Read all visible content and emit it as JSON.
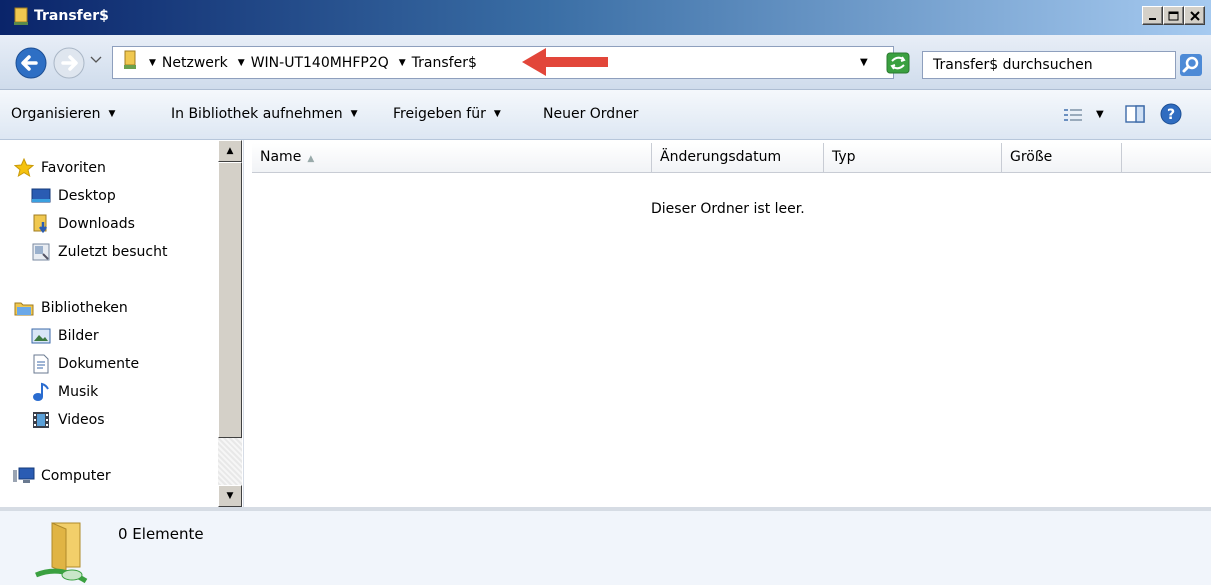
{
  "window": {
    "title": "Transfer$"
  },
  "address": {
    "crumbs": [
      "Netzwerk",
      "WIN-UT140MHFP2Q",
      "Transfer$"
    ]
  },
  "search": {
    "placeholder": "Transfer$ durchsuchen"
  },
  "toolbar": {
    "organize": "Organisieren",
    "include_library": "In Bibliothek aufnehmen",
    "share_with": "Freigeben für",
    "new_folder": "Neuer Ordner"
  },
  "navpane": {
    "favorites": "Favoriten",
    "desktop": "Desktop",
    "downloads": "Downloads",
    "recent": "Zuletzt besucht",
    "libraries": "Bibliotheken",
    "pictures": "Bilder",
    "documents": "Dokumente",
    "music": "Musik",
    "videos": "Videos",
    "computer": "Computer"
  },
  "columns": {
    "name": "Name",
    "date": "Änderungsdatum",
    "type": "Typ",
    "size": "Größe"
  },
  "content": {
    "empty_message": "Dieser Ordner ist leer."
  },
  "details": {
    "count": "0 Elemente"
  },
  "colors": {
    "annotation_arrow": "#e2463a",
    "titlebar_start": "#0a246a"
  }
}
